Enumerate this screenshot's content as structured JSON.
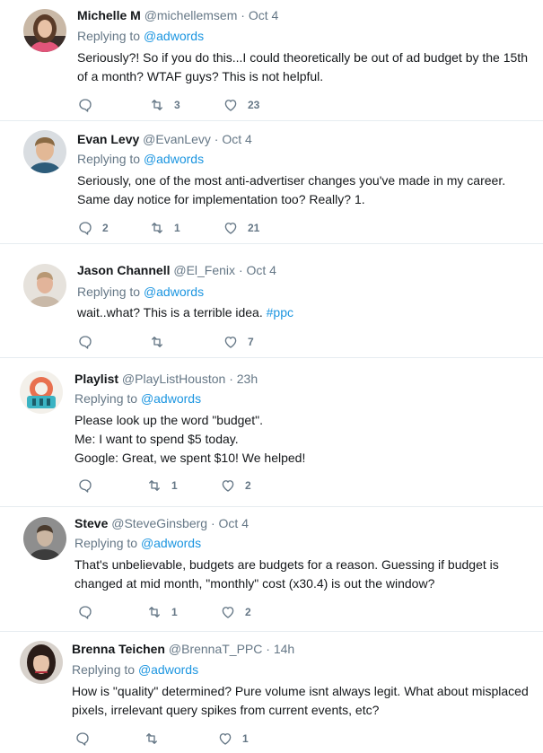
{
  "replies": [
    {
      "name": "Michelle M",
      "handle": "@michellemsem",
      "dot": "·",
      "time": "Oct 4",
      "replying_prefix": "Replying to",
      "replying_to": "@adwords",
      "lines": [
        "Seriously?! So if you do this...I could theoretically be out of ad budget by the 15th",
        "of a month? WTAF guys? This is not helpful."
      ],
      "replies_count": "",
      "retweets_count": "3",
      "likes_count": "23"
    },
    {
      "name": "Evan Levy",
      "handle": "@EvanLevy",
      "dot": "·",
      "time": "Oct 4",
      "replying_prefix": "Replying to",
      "replying_to": "@adwords",
      "lines": [
        "Seriously, one of the most anti-advertiser changes you've made in my career.",
        "Same day notice for implementation too? Really? 1."
      ],
      "replies_count": "2",
      "retweets_count": "1",
      "likes_count": "21"
    },
    {
      "name": "Jason Channell",
      "handle": "@El_Fenix",
      "dot": "·",
      "time": "Oct 4",
      "replying_prefix": "Replying to",
      "replying_to": "@adwords",
      "lines_prefix": "wait..what? This is a terrible idea. ",
      "hashtag": "#ppc",
      "replies_count": "",
      "retweets_count": "",
      "likes_count": "7"
    },
    {
      "name": "Playlist",
      "handle": "@PlayListHouston",
      "dot": "·",
      "time": "23h",
      "replying_prefix": "Replying to",
      "replying_to": "@adwords",
      "lines": [
        "Please look up the word \"budget\".",
        "Me: I want to spend $5 today.",
        "Google: Great, we spent $10! We helped!"
      ],
      "replies_count": "",
      "retweets_count": "1",
      "likes_count": "2"
    },
    {
      "name": "Steve",
      "handle": "@SteveGinsberg",
      "dot": "·",
      "time": "Oct 4",
      "replying_prefix": "Replying to",
      "replying_to": "@adwords",
      "lines": [
        "That's unbelievable, budgets are budgets for a reason. Guessing if budget is",
        "changed at mid month, \"monthly\" cost (x30.4) is out the window?"
      ],
      "replies_count": "",
      "retweets_count": "1",
      "likes_count": "2"
    },
    {
      "name": "Brenna Teichen",
      "handle": "@BrennaT_PPC",
      "dot": "·",
      "time": "14h",
      "replying_prefix": "Replying to",
      "replying_to": "@adwords",
      "lines": [
        "How is \"quality\" determined? Pure volume isnt always legit. What about misplaced",
        "pixels, irrelevant query spikes from current events, etc?"
      ],
      "replies_count": "",
      "retweets_count": "",
      "likes_count": "1"
    }
  ],
  "icons": {
    "reply": "reply-icon",
    "retweet": "retweet-icon",
    "like": "heart-icon"
  },
  "colors": {
    "name": "#14171a",
    "meta": "#657786",
    "link": "#1b95e0",
    "divider": "#e6ecf0"
  }
}
